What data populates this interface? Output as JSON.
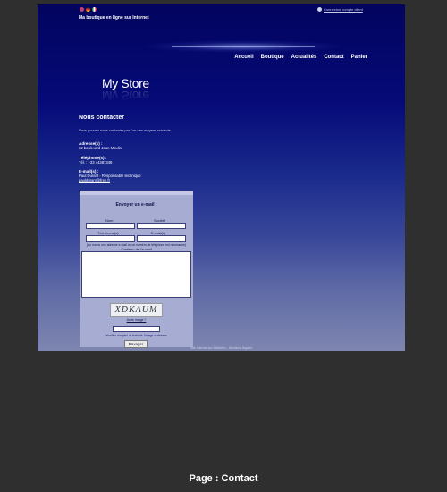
{
  "header": {
    "tagline": "Ma boutique en ligne sur Internet",
    "client_link": "Connexion compte client",
    "flags": [
      "fr-flag-icon",
      "uk-flag-icon",
      "de-flag-icon",
      "it-flag-icon"
    ]
  },
  "nav": {
    "items": [
      "Accueil",
      "Boutique",
      "Actualités",
      "Contact",
      "Panier"
    ]
  },
  "logo": {
    "text": "My Store"
  },
  "main": {
    "title": "Nous contacter",
    "intro": "Vous pouvez nous contacter par l'un des moyens suivants",
    "address": {
      "label": "Adresse(s) :",
      "value": "62 boulevard Jean Moulin"
    },
    "phone": {
      "label": "Téléphone(s) :",
      "value": "Tél. : +33 44387349"
    },
    "email": {
      "label": "E-mail(s) :",
      "name": "Paul Durant - Responsable technique",
      "address": "pauldurant@free.fr"
    }
  },
  "form": {
    "title": "Envoyer un e-mail :",
    "name_label": "Nom",
    "company_label": "Société",
    "phone_label": "Téléphone(s)",
    "email_label": "E-mail(s)",
    "required_note": "(Au moins une adresse e-mail ou un numéro de téléphone est nécessaire)",
    "message_label": "Contenu de l'e-mail",
    "captcha_text": "XDKAUM",
    "new_code": "Autre image ?",
    "captcha_note": "Veuillez recopier le texte de l'image ci-dessus",
    "submit": "Envoyer"
  },
  "footer": {
    "text": "Site Internet sur Métaférix - Mentions légales"
  },
  "caption": "Page : Contact",
  "colors": {
    "page_bg": "#2f2f2f",
    "banner_top": "#02045e",
    "form_bg": "#a7acd2"
  }
}
